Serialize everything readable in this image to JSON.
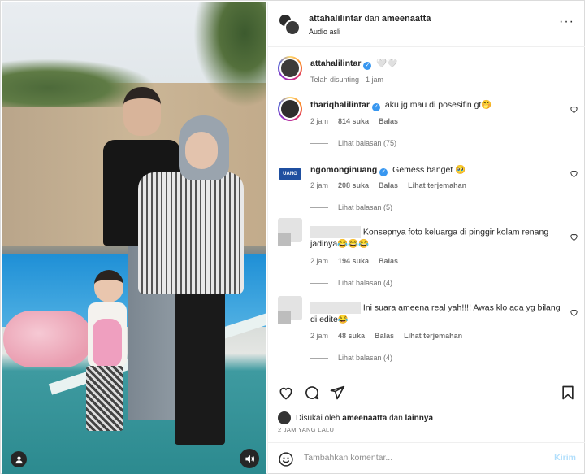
{
  "header": {
    "user1": "attahalilintar",
    "connector": "dan",
    "user2": "ameenaatta",
    "subtitle": "Audio asli"
  },
  "caption": {
    "username": "attahalilintar",
    "text": "🤍🤍",
    "meta": "Telah disunting · 1 jam"
  },
  "comments": [
    {
      "username": "thariqhalilintar",
      "verified": true,
      "text": "aku jg mau di posesifin gt🤭",
      "time": "2 jam",
      "likes": "814 suka",
      "reply": "Balas",
      "translate": "",
      "view_replies": "Lihat balasan (75)"
    },
    {
      "username": "ngomonginuang",
      "verified": true,
      "text": "Gemess banget 🥹",
      "time": "2 jam",
      "likes": "208 suka",
      "reply": "Balas",
      "translate": "Lihat terjemahan",
      "view_replies": "Lihat balasan (5)"
    },
    {
      "username": "",
      "verified": false,
      "text": "Konsepnya foto keluarga di pinggir kolam renang jadinya😂😂😂",
      "time": "2 jam",
      "likes": "194 suka",
      "reply": "Balas",
      "translate": "",
      "view_replies": "Lihat balasan (4)"
    },
    {
      "username": "",
      "verified": false,
      "text": "Ini suara ameena real yah!!!! Awas klo ada yg bilang di edite😂",
      "time": "2 jam",
      "likes": "48 suka",
      "reply": "Balas",
      "translate": "Lihat terjemahan",
      "view_replies": "Lihat balasan (4)"
    }
  ],
  "liked_by": {
    "prefix": "Disukai oleh",
    "user": "ameenaatta",
    "connector": "dan",
    "others": "lainnya"
  },
  "time_ago": "2 JAM YANG LALU",
  "composer": {
    "placeholder": "Tambahkan komentar...",
    "post": "Kirim"
  },
  "icons": [
    "more-icon",
    "verified-icon",
    "heart-icon",
    "comment-icon",
    "share-icon",
    "bookmark-icon",
    "emoji-icon",
    "user-tag-icon",
    "audio-icon"
  ],
  "colors": {
    "verified": "#3897f0",
    "link_disabled": "#b2dffc",
    "muted": "#737373"
  }
}
